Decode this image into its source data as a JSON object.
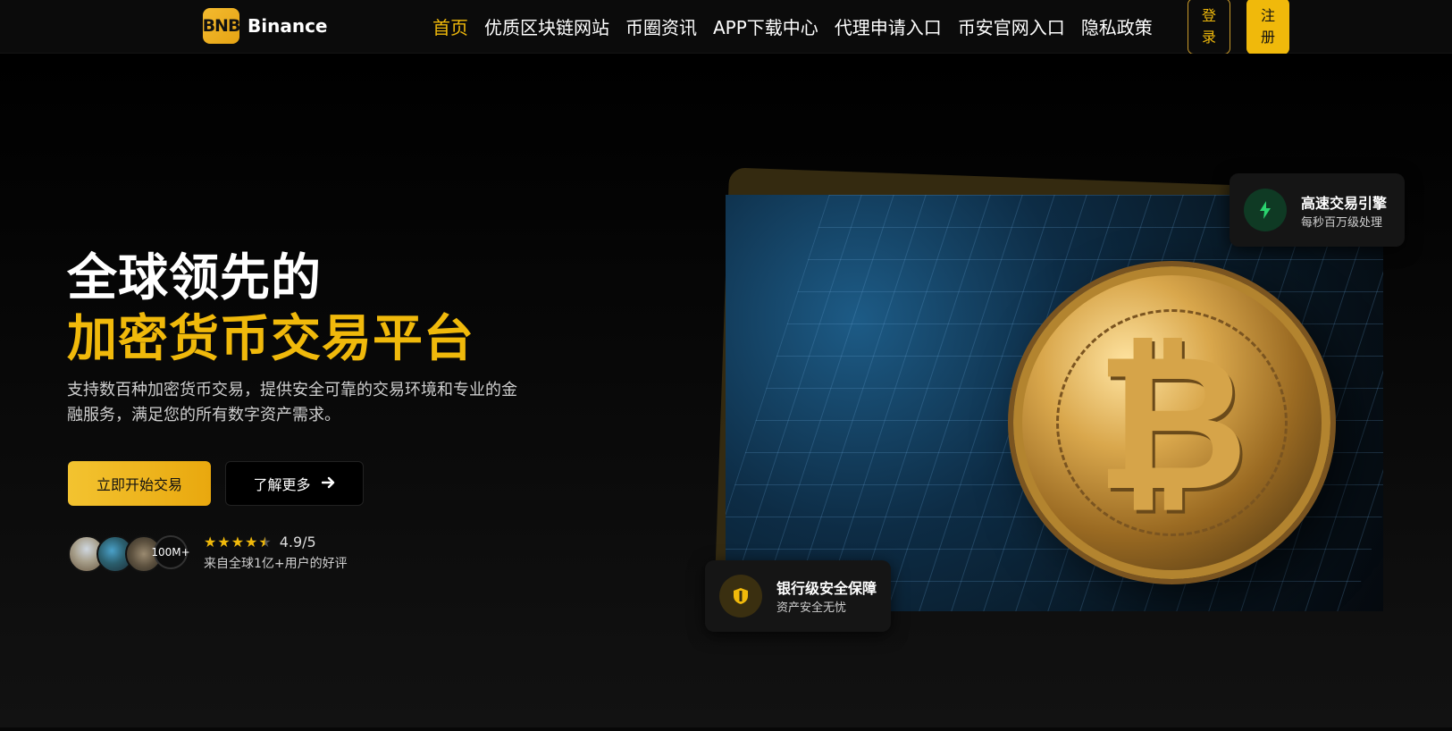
{
  "brand": {
    "badge": "BNB",
    "name": "Binance"
  },
  "nav": {
    "items": [
      {
        "label": "首页",
        "active": true
      },
      {
        "label": "优质区块链网站",
        "active": false
      },
      {
        "label": "币圈资讯",
        "active": false
      },
      {
        "label": "APP下载中心",
        "active": false
      },
      {
        "label": "代理申请入口",
        "active": false
      },
      {
        "label": "币安官网入口",
        "active": false
      },
      {
        "label": "隐私政策",
        "active": false
      }
    ],
    "login_label": "登录",
    "register_label": "注册"
  },
  "hero": {
    "title_line1": "全球领先的",
    "title_line2": "加密货币交易平台",
    "description": "支持数百种加密货币交易，提供安全可靠的交易环境和专业的金融服务，满足您的所有数字资产需求。",
    "primary_cta": "立即开始交易",
    "secondary_cta": "了解更多",
    "users_badge": "100M+",
    "rating_score": "4.9/5",
    "rating_stars": 4.5,
    "rating_sub": "来自全球1亿+用户的好评"
  },
  "badges": {
    "speed": {
      "title": "高速交易引擎",
      "subtitle": "每秒百万级处理",
      "icon": "lightning-icon"
    },
    "security": {
      "title": "银行级安全保障",
      "subtitle": "资产安全无忧",
      "icon": "shield-icon"
    }
  },
  "colors": {
    "accent": "#f0b90b",
    "background": "#000000",
    "speed_icon": "#2ad36e"
  }
}
